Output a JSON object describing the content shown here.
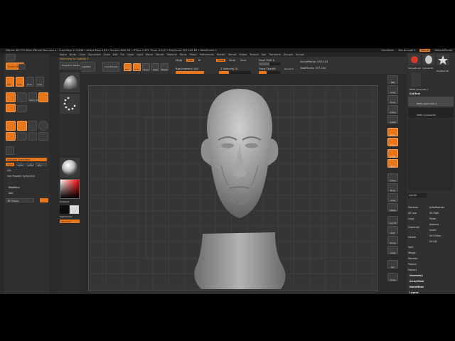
{
  "window": {
    "title": "ZBrush 4R7 P3 (64x)  ZBrush Document   • Free Mem 114.498 • Active Mem 193 • Scratch Disk 50 • ZTime 1.473 Timer 0.012 • PolyCount 557.144 KP • MeshCount 1",
    "quicksave_label": "QuickSave",
    "seethrough_label": "See-through 0",
    "menus_label": "Menus",
    "default_zscript_label": "DefaultZScript"
  },
  "menubar": [
    "Alpha",
    "Brush",
    "Color",
    "Document",
    "Draw",
    "Edit",
    "File",
    "Layer",
    "Light",
    "Macro",
    "Marker",
    "Material",
    "Movie",
    "Picker",
    "Preferences",
    "Render",
    "Stencil",
    "Stroke",
    "Texture",
    "Tool",
    "Transform",
    "Zplugin",
    "Zscript"
  ],
  "shelf": {
    "switch_label": "Switching to Subtool 3",
    "projection_label": "Projection Master",
    "lightbox_label": "LightBox",
    "liveboolean_label": "Live Boolean",
    "edit_label": "Edit",
    "draw_label": "Draw",
    "move_label": "Move",
    "scale_label": "Scale",
    "rotate_label": "Rotate",
    "mrgb_label": "Mrgb",
    "rgb_label": "Rgb",
    "m_label": "M",
    "zadd_label": "Zadd",
    "zsub_label": "Zsub",
    "zcut_label": "Zcut",
    "rgb_intensity_label": "Rgb Intensity 100",
    "z_intensity_label": "Z Intensity 31",
    "focal_shift_label": "Focal Shift 0",
    "draw_size_label": "Draw Size 64",
    "dynamic_label": "Dynamic",
    "active_points_label": "ActivePoints: 555,314",
    "total_points_label": "TotalPoints: 557,144",
    "rgb_intensity": 1.0,
    "z_intensity": 0.31,
    "focal_shift": 0.5,
    "draw_size": 0.35
  },
  "leftpal": {
    "quicksketch_label": "Quick Sketch",
    "edit_label": "Edit",
    "draw_label": "Draw",
    "move_label": "Move",
    "scale_label": "Scale",
    "rotate_label": "Rotate",
    "gizmo_label": "Gizmo 3D",
    "activate_symmetry_label": "Activate Symmetry",
    "x_label": ">X<",
    "y_label": ">Y<",
    "z_label": ">Z<",
    "m_label": "(M)",
    "radial_label": "(R)",
    "posable_label": "Use Posable Symmetry",
    "modifiers_label": "Modifiers",
    "info_label": "Info",
    "rf_label": "RF Focus"
  },
  "brushcol": {
    "gradient_label": "Gradient",
    "switchcolor_label": "SwitchColor",
    "alternate_label": "Alternate"
  },
  "rcol": {
    "buttons": [
      "BPR",
      "Scroll",
      "Zoom",
      "Actual",
      "AAHalf",
      "Persp",
      "Floor",
      "Local",
      "LSym",
      "Frame",
      "Move",
      "Scale",
      "Rotate",
      "Line Fill",
      "PolyF",
      "Transp",
      "Ghost",
      "Solo",
      "Xpose"
    ]
  },
  "rpanel": {
    "subtool_label": "SubTool",
    "pm3d_label": "PM3D_Sphere3D_1",
    "item2_label": "PM3D_Cylinder3D",
    "list_all_label": "List All",
    "rename_label": "Rename",
    "autoreorder_label": "AutoReorder",
    "all_low_label": "All Low",
    "all_high_label": "All High",
    "copy_label": "Copy",
    "paste_label": "Paste",
    "append_label": "Append",
    "duplicate_label": "Duplicate",
    "insert_label": "Insert",
    "delete_label": "Delete",
    "del_other_label": "Del Other",
    "del_all_label": "Del All",
    "split_label": "Split",
    "merge_label": "Merge",
    "remesh_label": "Remesh",
    "project_label": "Project",
    "extract_label": "Extract",
    "geometry_label": "Geometry",
    "arraymesh_label": "ArrayMesh",
    "nanomesh_label": "NanoMesh",
    "layers_label": "Layers",
    "simple_label": "SimpleBrush",
    "cylinder_label": "Cylinder3D",
    "polymesh_label": "PolyMesh3D",
    "sphere_label": "PM3D_Sphere3D_1"
  },
  "colors": {
    "accent": "#e8771c",
    "panel": "#303030",
    "canvas": "#353535"
  }
}
